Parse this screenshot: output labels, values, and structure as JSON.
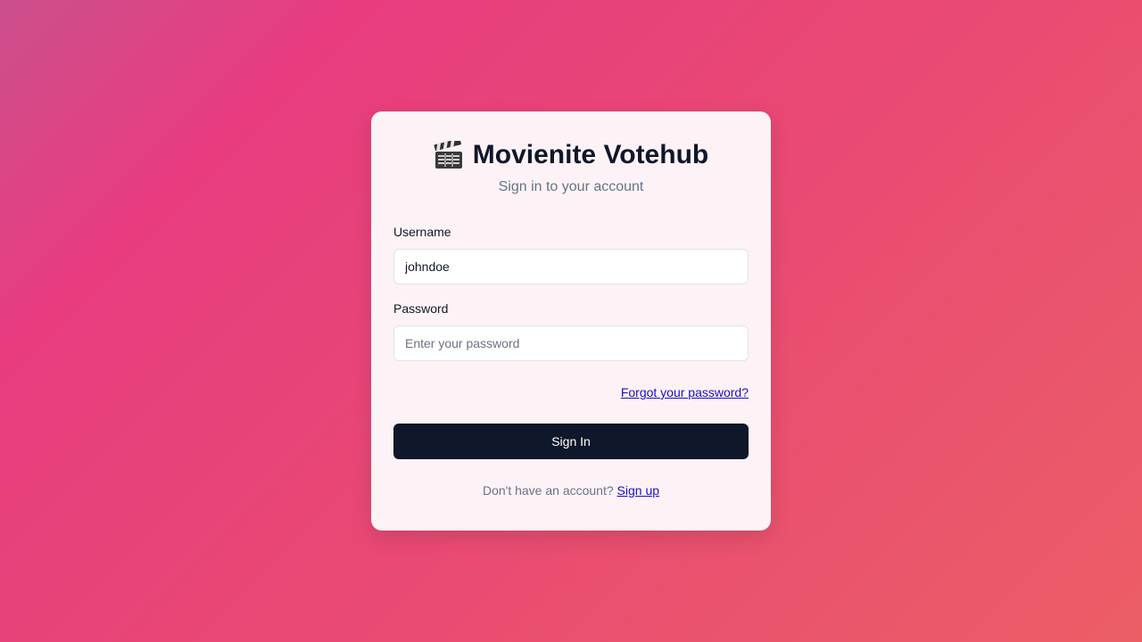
{
  "app": {
    "title": "Movienite Votehub",
    "subtitle": "Sign in to your account",
    "logo_icon": "clapperboard-icon"
  },
  "form": {
    "username": {
      "label": "Username",
      "value": "johndoe",
      "placeholder": ""
    },
    "password": {
      "label": "Password",
      "value": "",
      "placeholder": "Enter your password"
    },
    "forgot_label": "Forgot your password?",
    "submit_label": "Sign In"
  },
  "footer": {
    "prompt": "Don't have an account?",
    "signup_label": "Sign up"
  },
  "colors": {
    "primary_button": "#0f172a",
    "link": "#1a0dcc",
    "card_background": "#fdf3f6",
    "page_gradient_start": "#cc4f8c",
    "page_gradient_end": "#eb5e66"
  }
}
